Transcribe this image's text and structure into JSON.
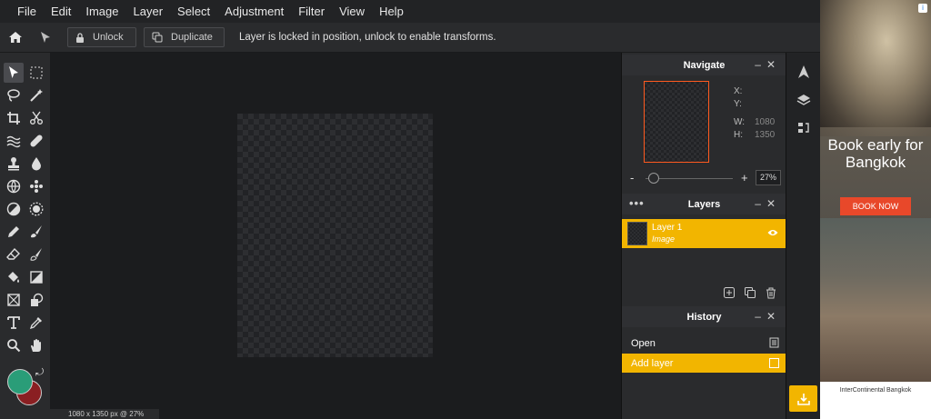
{
  "menu": [
    "File",
    "Edit",
    "Image",
    "Layer",
    "Select",
    "Adjustment",
    "Filter",
    "View",
    "Help"
  ],
  "options": {
    "unlock_label": "Unlock",
    "duplicate_label": "Duplicate",
    "message": "Layer is locked in position, unlock to enable transforms."
  },
  "colors": {
    "foreground": "#2a9d78",
    "background": "#8a1f22",
    "accent": "#f2b500",
    "nav_border": "#ff5a1f"
  },
  "status": "1080 x 1350 px @ 27%",
  "navigate": {
    "title": "Navigate",
    "x_label": "X:",
    "y_label": "Y:",
    "w_label": "W:",
    "w_value": "1080",
    "h_label": "H:",
    "h_value": "1350",
    "zoom_minus": "-",
    "zoom_plus": "+",
    "zoom": "27%"
  },
  "layers": {
    "title": "Layers",
    "items": [
      {
        "name": "Layer 1",
        "type": "Image"
      }
    ]
  },
  "history": {
    "title": "History",
    "items": [
      {
        "label": "Open"
      },
      {
        "label": "Add layer"
      }
    ]
  },
  "ad": {
    "title": "Book early for Bangkok",
    "cta": "BOOK NOW",
    "footer": "InterContinental Bangkok"
  }
}
